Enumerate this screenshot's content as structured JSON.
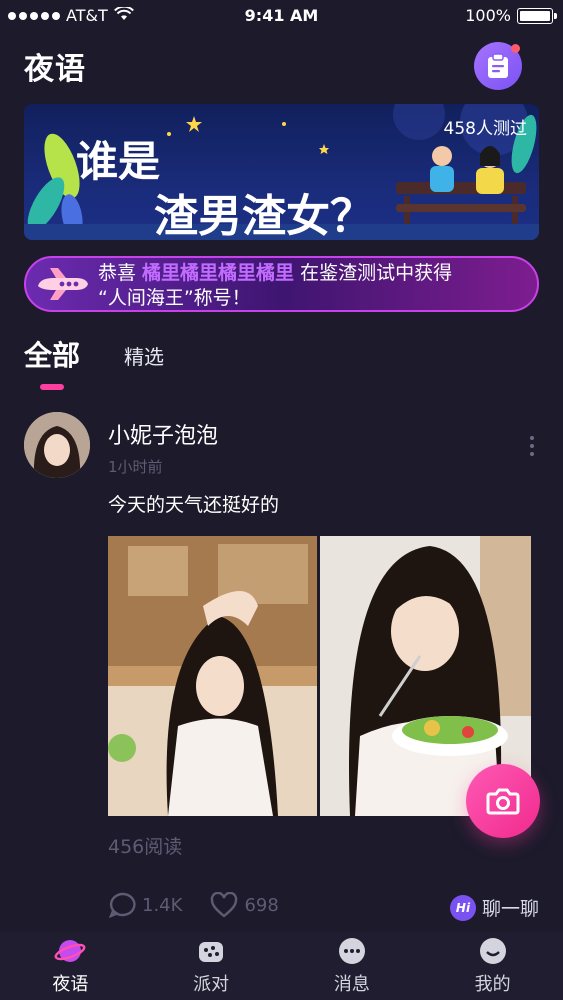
{
  "status_bar": {
    "carrier": "AT&T",
    "time": "9:41 AM",
    "battery": "100%"
  },
  "header": {
    "title": "夜语"
  },
  "banner": {
    "line1": "谁是",
    "line2": "渣男渣女？",
    "participants": "458人测过"
  },
  "notice": {
    "prefix": "恭喜 ",
    "user": "橘里橘里橘里橘里",
    "suffix": " 在鉴渣测试中获得",
    "line2": "“人间海王”称号！"
  },
  "tabs": [
    {
      "label": "全部"
    },
    {
      "label": "精选"
    }
  ],
  "post": {
    "author": "小妮子泡泡",
    "time": "1小时前",
    "text": "今天的天气还挺好的",
    "reads": "456阅读",
    "comments": "1.4K",
    "likes": "698",
    "chat_label": "聊一聊",
    "chat_badge": "Hi"
  },
  "tabbar": [
    {
      "label": "夜语"
    },
    {
      "label": "派对"
    },
    {
      "label": "消息"
    },
    {
      "label": "我的"
    }
  ],
  "colors": {
    "background": "#1c1a2b",
    "accent_pink": "#ff3fa0",
    "accent_purple": "#7b52f2",
    "highlight": "#c26bff"
  }
}
